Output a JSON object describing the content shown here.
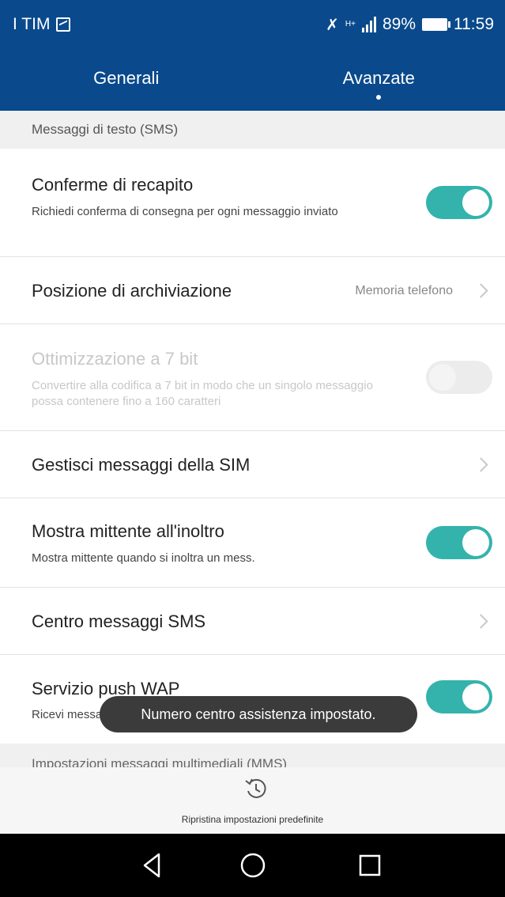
{
  "status_bar": {
    "carrier": "I TIM",
    "network": "H+",
    "battery": "89%",
    "time": "11:59"
  },
  "tabs": [
    {
      "label": "Generali",
      "active": false
    },
    {
      "label": "Avanzate",
      "active": true
    }
  ],
  "sms_section": {
    "title": "Messaggi di testo (SMS)",
    "items": [
      {
        "title": "Conferme di recapito",
        "subtitle": "Richiedi conferma di consegna per ogni messaggio inviato",
        "toggle": "on"
      },
      {
        "title": "Posizione di archiviazione",
        "value": "Memoria telefono"
      },
      {
        "title": "Ottimizzazione a 7 bit",
        "subtitle": "Convertire alla codifica a 7 bit in modo che un singolo messaggio possa contenere fino a 160 caratteri",
        "toggle": "off",
        "disabled": true
      },
      {
        "title": "Gestisci messaggi della SIM"
      },
      {
        "title": "Mostra mittente all'inoltro",
        "subtitle": "Mostra mittente quando si inoltra un mess.",
        "toggle": "on"
      },
      {
        "title": "Centro messaggi SMS"
      },
      {
        "title": "Servizio push WAP",
        "subtitle": "Ricevi messaggi",
        "toggle": "on"
      }
    ]
  },
  "mms_section": {
    "title": "Impostazioni messaggi multimediali (MMS)"
  },
  "toast": "Numero centro assistenza impostato.",
  "bottom_action": {
    "icon": "restore-icon",
    "label": "Ripristina impostazioni predefinite"
  },
  "colors": {
    "header_blue": "#0a4a8c",
    "toggle_on": "#34b3ad",
    "toggle_off": "#ececec"
  }
}
